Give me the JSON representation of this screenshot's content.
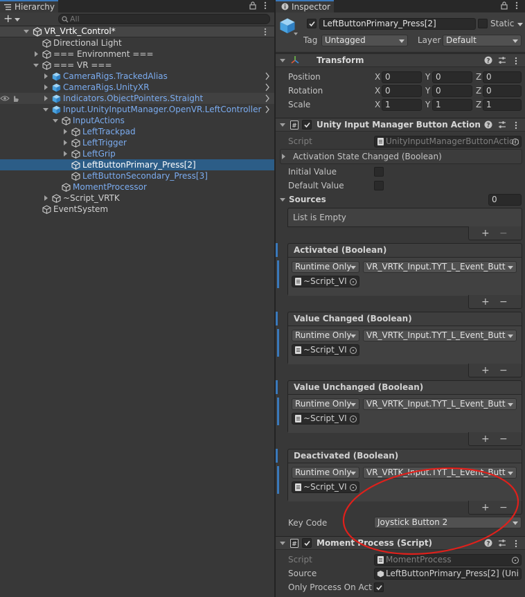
{
  "hierarchy": {
    "tab_label": "Hierarchy",
    "add_label": "+",
    "search_placeholder": "All",
    "scene_name": "VR_Vrtk_Control*",
    "rows": [
      {
        "label": "Directional Light"
      },
      {
        "label": "=== Environment ==="
      },
      {
        "label": "=== VR ==="
      },
      {
        "label": "CameraRigs.TrackedAlias"
      },
      {
        "label": "CameraRigs.UnityXR"
      },
      {
        "label": "Indicators.ObjectPointers.Straight"
      },
      {
        "label": "Input.UnityInputManager.OpenVR.LeftController"
      },
      {
        "label": "InputActions"
      },
      {
        "label": "LeftTrackpad"
      },
      {
        "label": "LeftTrigger"
      },
      {
        "label": "LeftGrip"
      },
      {
        "label": "LeftButtonPrimary_Press[2]"
      },
      {
        "label": "LeftButtonSecondary_Press[3]"
      },
      {
        "label": "MomentProcessor"
      },
      {
        "label": "~Script_VRTK"
      },
      {
        "label": "EventSystem"
      }
    ]
  },
  "inspector": {
    "tab_label": "Inspector",
    "object_name": "LeftButtonPrimary_Press[2]",
    "static_label": "Static",
    "tag_label": "Tag",
    "tag_value": "Untagged",
    "layer_label": "Layer",
    "layer_value": "Default",
    "transform": {
      "title": "Transform",
      "position_label": "Position",
      "rotation_label": "Rotation",
      "scale_label": "Scale",
      "x": "X",
      "y": "Y",
      "z": "Z",
      "position": [
        "0",
        "0",
        "0"
      ],
      "rotation": [
        "0",
        "0",
        "0"
      ],
      "scale": [
        "1",
        "1",
        "1"
      ]
    },
    "button_action": {
      "title": "Unity Input Manager Button Action (Scrip",
      "script_label": "Script",
      "script_value": "UnityInputManagerButtonAction",
      "activation_state": "Activation State Changed (Boolean)",
      "initial_value_label": "Initial Value",
      "default_value_label": "Default Value",
      "sources_label": "Sources",
      "sources_count": "0",
      "list_empty": "List is Empty",
      "plus": "+",
      "minus": "−",
      "events": [
        {
          "title": "Activated (Boolean)",
          "mode": "Runtime Only",
          "function": "VR_VRTK_Input.TYT_L_Event_Butt",
          "object": "~Script_VI"
        },
        {
          "title": "Value Changed (Boolean)",
          "mode": "Runtime Only",
          "function": "VR_VRTK_Input.TYT_L_Event_Butt",
          "object": "~Script_VI"
        },
        {
          "title": "Value Unchanged (Boolean)",
          "mode": "Runtime Only",
          "function": "VR_VRTK_Input.TYT_L_Event_Butt",
          "object": "~Script_VI"
        },
        {
          "title": "Deactivated (Boolean)",
          "mode": "Runtime Only",
          "function": "VR_VRTK_Input.TYT_L_Event_Butt",
          "object": "~Script_VI"
        }
      ],
      "key_code_label": "Key Code",
      "key_code_value": "Joystick Button 2"
    },
    "moment_process": {
      "title": "Moment Process (Script)",
      "script_label": "Script",
      "script_value": "MomentProcess",
      "source_label": "Source",
      "source_value": "LeftButtonPrimary_Press[2] (Uni",
      "only_process_label": "Only Process On Activ"
    }
  },
  "colors": {
    "selection": "#2c5d87",
    "accent_blue": "#3a79bb",
    "annotation_red": "#e0201b"
  }
}
